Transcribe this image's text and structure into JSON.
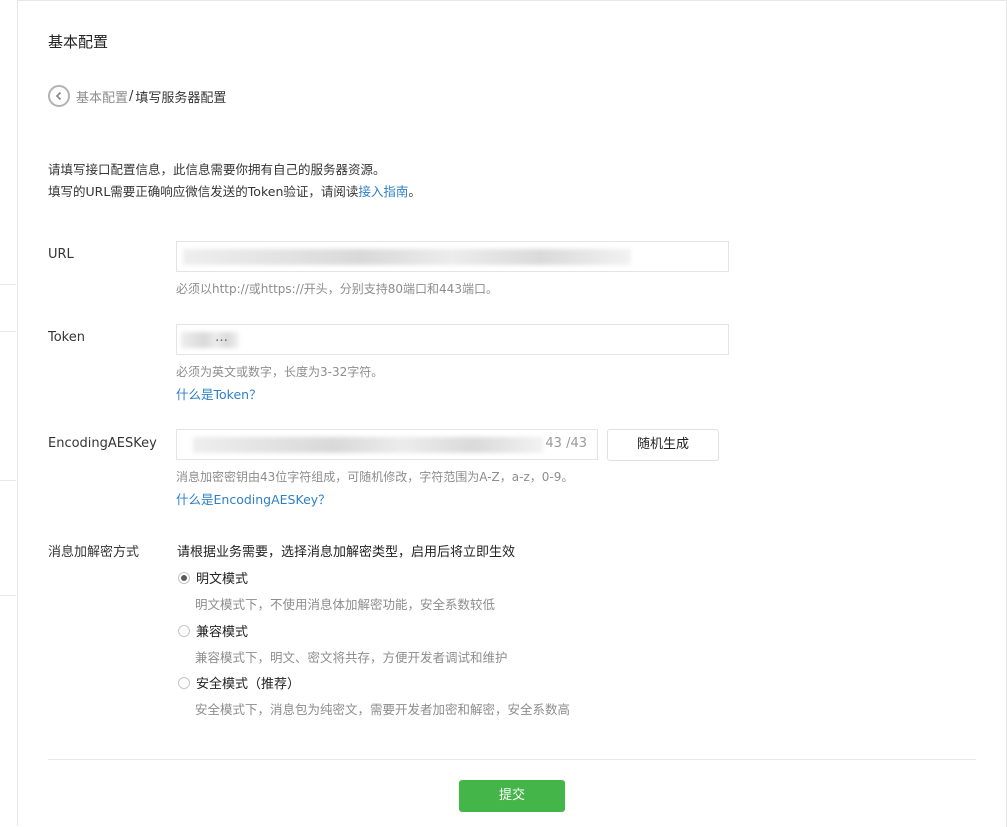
{
  "page": {
    "title": "基本配置"
  },
  "breadcrumb": {
    "parent": "基本配置",
    "separator": "/",
    "current": "填写服务器配置"
  },
  "intro": {
    "line1": "请填写接口配置信息，此信息需要你拥有自己的服务器资源。",
    "line2_prefix": "填写的URL需要正确响应微信发送的Token验证，请阅读",
    "line2_link": "接入指南",
    "line2_suffix": "。"
  },
  "form": {
    "url": {
      "label": "URL",
      "hint": "必须以http://或https://开头，分别支持80端口和443端口。"
    },
    "token": {
      "label": "Token",
      "value_visible": "…",
      "hint": "必须为英文或数字，长度为3-32字符。",
      "help_link": "什么是Token？"
    },
    "aeskey": {
      "label": "EncodingAESKey",
      "counter": "43 /43",
      "random_button": "随机生成",
      "hint": "消息加密密钥由43位字符组成，可随机修改，字符范围为A-Z，a-z，0-9。",
      "help_link": "什么是EncodingAESKey？"
    },
    "encryption": {
      "label": "消息加解密方式",
      "description": "请根据业务需要，选择消息加解密类型，启用后将立即生效",
      "options": [
        {
          "label": "明文模式",
          "desc": "明文模式下，不使用消息体加解密功能，安全系数较低",
          "checked": true
        },
        {
          "label": "兼容模式",
          "desc": "兼容模式下，明文、密文将共存，方便开发者调试和维护",
          "checked": false
        },
        {
          "label": "安全模式（推荐）",
          "desc": "安全模式下，消息包为纯密文，需要开发者加密和解密，安全系数高",
          "checked": false
        }
      ]
    },
    "submit_label": "提交"
  },
  "colors": {
    "primary": "#44b549",
    "link": "#2e80c6",
    "hint": "#8d8d8d",
    "border": "#e7e7eb"
  },
  "icons": {
    "back": "chevron-left-circle-icon"
  }
}
